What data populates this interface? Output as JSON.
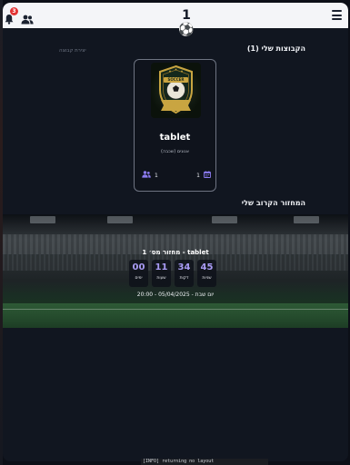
{
  "header": {
    "logo_text": "1⚽",
    "notification_count": "3"
  },
  "groups": {
    "title": "הקבוצות שלי (1)",
    "create_label": "יצירת קבוצה"
  },
  "team_card": {
    "logo_text": "SOCCER",
    "name": "tablet",
    "subtitle": "אנונים (שכבה)",
    "members_count": "1",
    "rounds_count": "1"
  },
  "next_round": {
    "section_title": "המחזור הקרוב שלי",
    "title": "מחזור מס׳ 1 - tablet",
    "countdown": [
      {
        "value": "45",
        "label": "שניות"
      },
      {
        "value": "34",
        "label": "דקות"
      },
      {
        "value": "11",
        "label": "שעות"
      },
      {
        "value": "00",
        "label": "ימים"
      }
    ],
    "date": "יום שבת - 05/04/2025 - 20:00"
  },
  "terminal": {
    "text": "[INFO] returning no layout"
  }
}
